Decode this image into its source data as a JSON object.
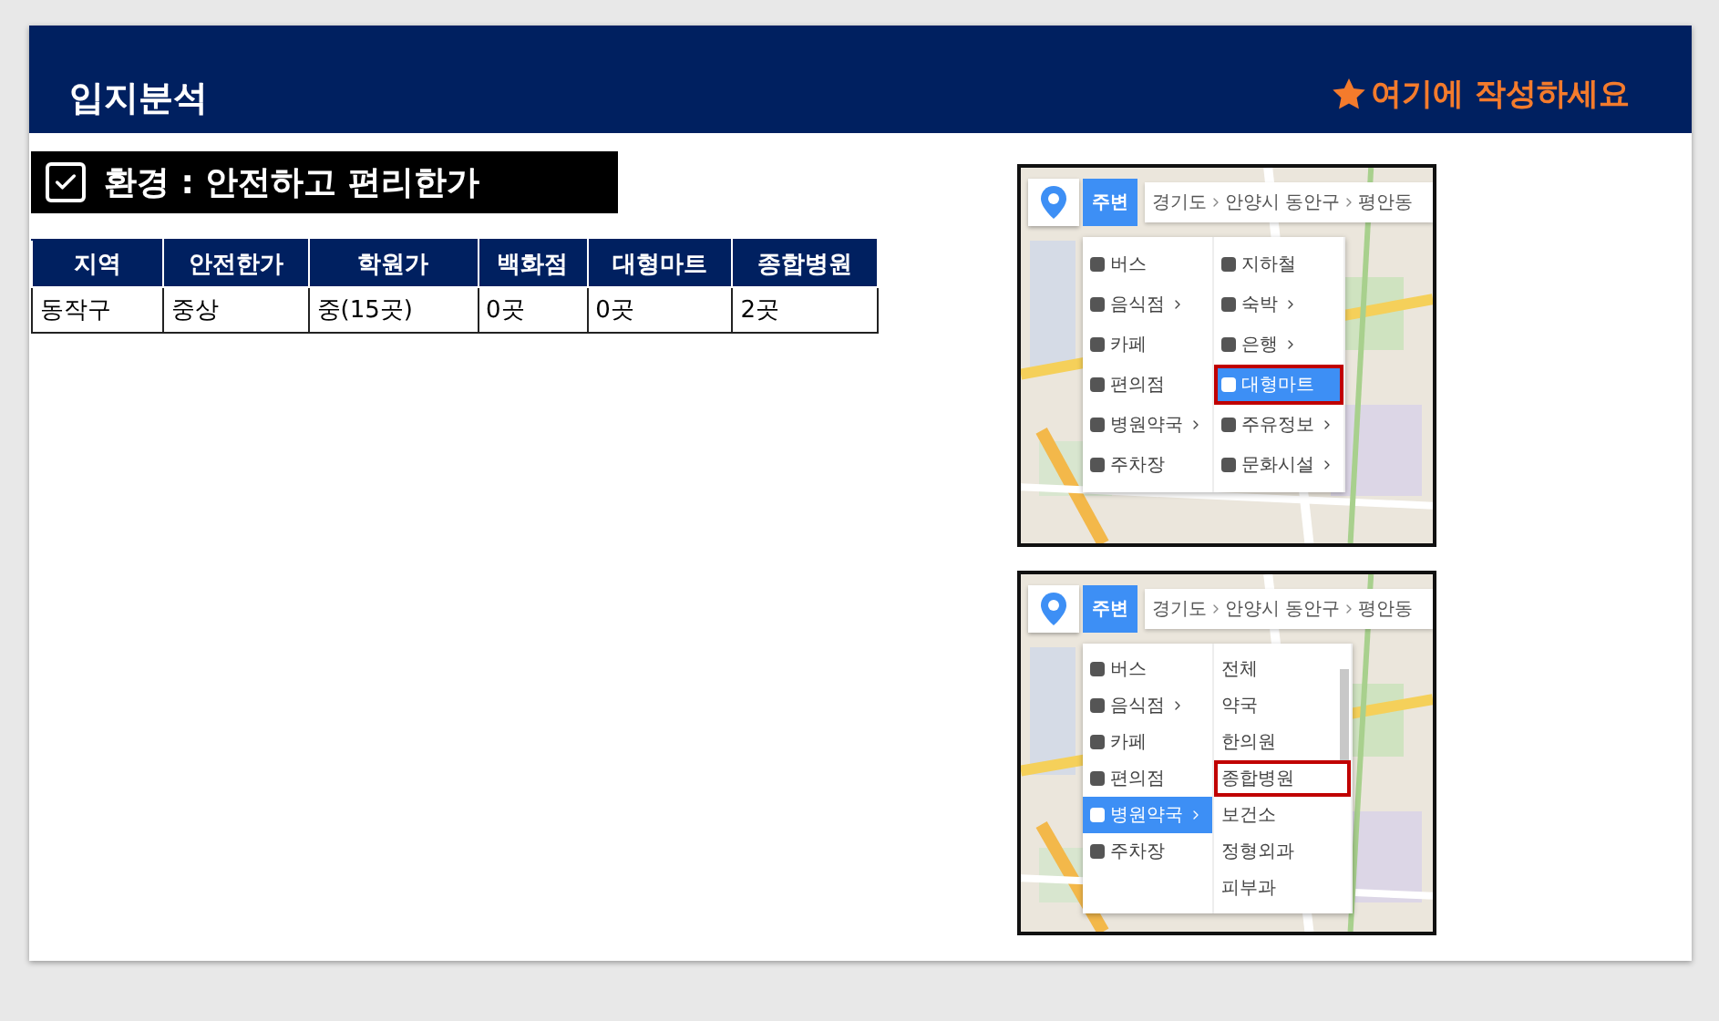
{
  "header": {
    "title": "입지분석",
    "note": "여기에 작성하세요"
  },
  "section": {
    "checked": true,
    "title": "환경 : 안전하고 편리한가"
  },
  "table": {
    "columns": [
      "지역",
      "안전한가",
      "학원가",
      "백화점",
      "대형마트",
      "종합병원"
    ],
    "rows": [
      [
        "동작구",
        "중상",
        "중(15곳)",
        "0곳",
        "0곳",
        "2곳"
      ]
    ]
  },
  "maps": [
    {
      "button": "주변",
      "breadcrumb": [
        "경기도",
        "안양시 동안구",
        "평안동"
      ],
      "columns": [
        {
          "kind": "icons",
          "items": [
            {
              "label": "버스",
              "arrow": false,
              "selected": false,
              "highlighted": false
            },
            {
              "label": "음식점",
              "arrow": true,
              "selected": false,
              "highlighted": false
            },
            {
              "label": "카페",
              "arrow": false,
              "selected": false,
              "highlighted": false
            },
            {
              "label": "편의점",
              "arrow": false,
              "selected": false,
              "highlighted": false
            },
            {
              "label": "병원약국",
              "arrow": true,
              "selected": false,
              "highlighted": false
            },
            {
              "label": "주차장",
              "arrow": false,
              "selected": false,
              "highlighted": false
            }
          ]
        },
        {
          "kind": "icons",
          "items": [
            {
              "label": "지하철",
              "arrow": false,
              "selected": false,
              "highlighted": false
            },
            {
              "label": "숙박",
              "arrow": true,
              "selected": false,
              "highlighted": false
            },
            {
              "label": "은행",
              "arrow": true,
              "selected": false,
              "highlighted": false
            },
            {
              "label": "대형마트",
              "arrow": false,
              "selected": true,
              "highlighted": true
            },
            {
              "label": "주유정보",
              "arrow": true,
              "selected": false,
              "highlighted": false
            },
            {
              "label": "문화시설",
              "arrow": true,
              "selected": false,
              "highlighted": false
            }
          ]
        }
      ]
    },
    {
      "button": "주변",
      "breadcrumb": [
        "경기도",
        "안양시 동안구",
        "평안동"
      ],
      "columns": [
        {
          "kind": "icons",
          "items": [
            {
              "label": "버스",
              "arrow": false,
              "selected": false,
              "highlighted": false
            },
            {
              "label": "음식점",
              "arrow": true,
              "selected": false,
              "highlighted": false
            },
            {
              "label": "카페",
              "arrow": false,
              "selected": false,
              "highlighted": false
            },
            {
              "label": "편의점",
              "arrow": false,
              "selected": false,
              "highlighted": false
            },
            {
              "label": "병원약국",
              "arrow": true,
              "selected": true,
              "highlighted": false
            },
            {
              "label": "주차장",
              "arrow": false,
              "selected": false,
              "highlighted": false
            }
          ]
        },
        {
          "kind": "plain",
          "items": [
            {
              "label": "전체",
              "arrow": false,
              "selected": false,
              "highlighted": false
            },
            {
              "label": "약국",
              "arrow": false,
              "selected": false,
              "highlighted": false
            },
            {
              "label": "한의원",
              "arrow": false,
              "selected": false,
              "highlighted": false
            },
            {
              "label": "종합병원",
              "arrow": false,
              "selected": false,
              "highlighted": true
            },
            {
              "label": "보건소",
              "arrow": false,
              "selected": false,
              "highlighted": false
            },
            {
              "label": "정형외과",
              "arrow": false,
              "selected": false,
              "highlighted": false
            },
            {
              "label": "피부과",
              "arrow": false,
              "selected": false,
              "highlighted": false
            }
          ]
        }
      ]
    }
  ]
}
